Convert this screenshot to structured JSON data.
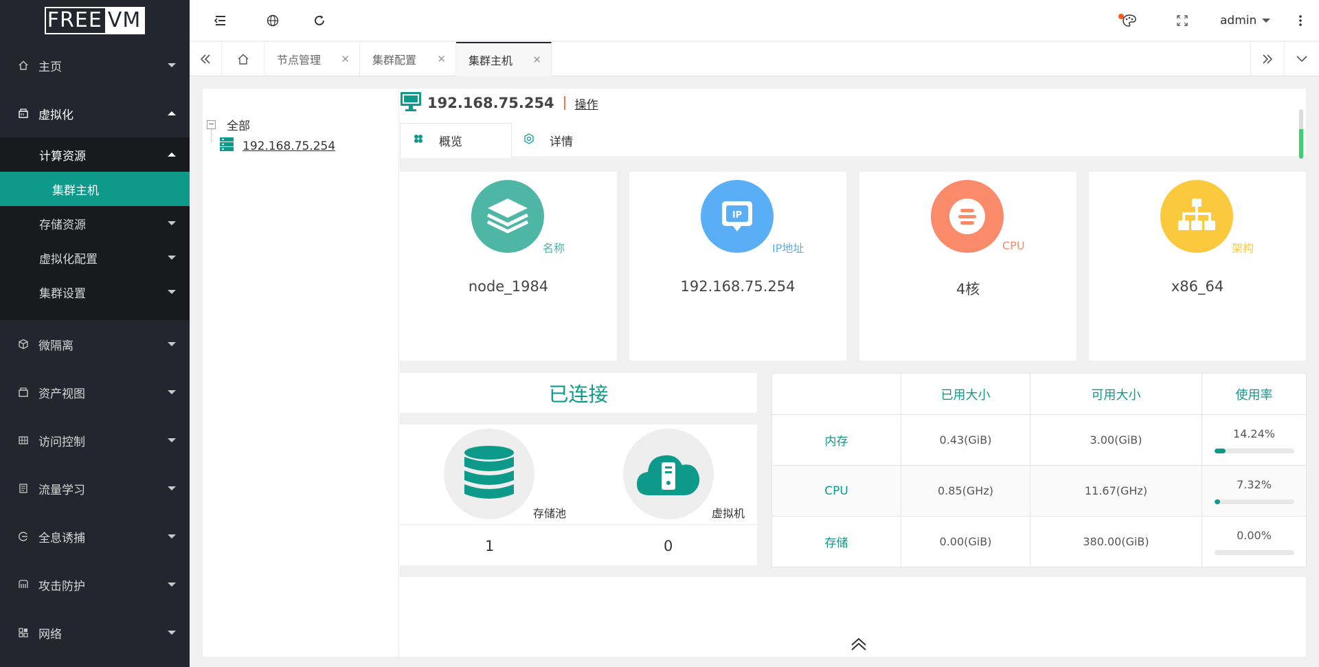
{
  "brand": {
    "part1": "FREE",
    "part2": "VM"
  },
  "sidebar": {
    "items": [
      {
        "label": "主页",
        "icon": "home-icon"
      },
      {
        "label": "虚拟化",
        "icon": "virtualization-icon"
      },
      {
        "label": "微隔离",
        "icon": "cube-icon"
      },
      {
        "label": "资产视图",
        "icon": "asset-icon"
      },
      {
        "label": "访问控制",
        "icon": "grid-icon"
      },
      {
        "label": "流量学习",
        "icon": "flow-icon"
      },
      {
        "label": "全息诱捕",
        "icon": "trap-icon"
      },
      {
        "label": "攻击防护",
        "icon": "shield-icon"
      },
      {
        "label": "网络",
        "icon": "network-icon"
      }
    ],
    "virt_sub": [
      {
        "label": "计算资源"
      },
      {
        "label": "存储资源"
      },
      {
        "label": "虚拟化配置"
      },
      {
        "label": "集群设置"
      }
    ],
    "compute_sub": [
      {
        "label": "集群主机",
        "active": true
      }
    ]
  },
  "header": {
    "user": "admin"
  },
  "tabs": [
    {
      "label": "节点管理"
    },
    {
      "label": "集群配置"
    },
    {
      "label": "集群主机",
      "active": true
    }
  ],
  "tree": {
    "root": "全部",
    "node": "192.168.75.254"
  },
  "host": {
    "ip": "192.168.75.254",
    "op": "操作"
  },
  "content_tabs": [
    {
      "label": "概览",
      "active": true
    },
    {
      "label": "详情"
    }
  ],
  "cards": [
    {
      "label": "名称",
      "value": "node_1984",
      "color": "#4db6a4"
    },
    {
      "label": "IP地址",
      "value": "192.168.75.254",
      "color": "#5aaef5"
    },
    {
      "label": "CPU",
      "value": "4核",
      "color": "#f98b6b"
    },
    {
      "label": "架构",
      "value": "x86_64",
      "color": "#fbc93d"
    }
  ],
  "connection": {
    "status": "已连接"
  },
  "resources": [
    {
      "label": "存储池",
      "count": "1"
    },
    {
      "label": "虚拟机",
      "count": "0"
    }
  ],
  "usage": {
    "headers": [
      "",
      "已用大小",
      "可用大小",
      "使用率"
    ],
    "rows": [
      {
        "name": "内存",
        "used": "0.43(GiB)",
        "avail": "3.00(GiB)",
        "rate": "14.24%",
        "fraction": 0.1424
      },
      {
        "name": "CPU",
        "used": "0.85(GHz)",
        "avail": "11.67(GHz)",
        "rate": "7.32%",
        "fraction": 0.0732
      },
      {
        "name": "存储",
        "used": "0.00(GiB)",
        "avail": "380.00(GiB)",
        "rate": "0.00%",
        "fraction": 0.0
      }
    ]
  },
  "colors": {
    "accent": "#0e9a8b",
    "sidebar_bg": "#23262e"
  }
}
